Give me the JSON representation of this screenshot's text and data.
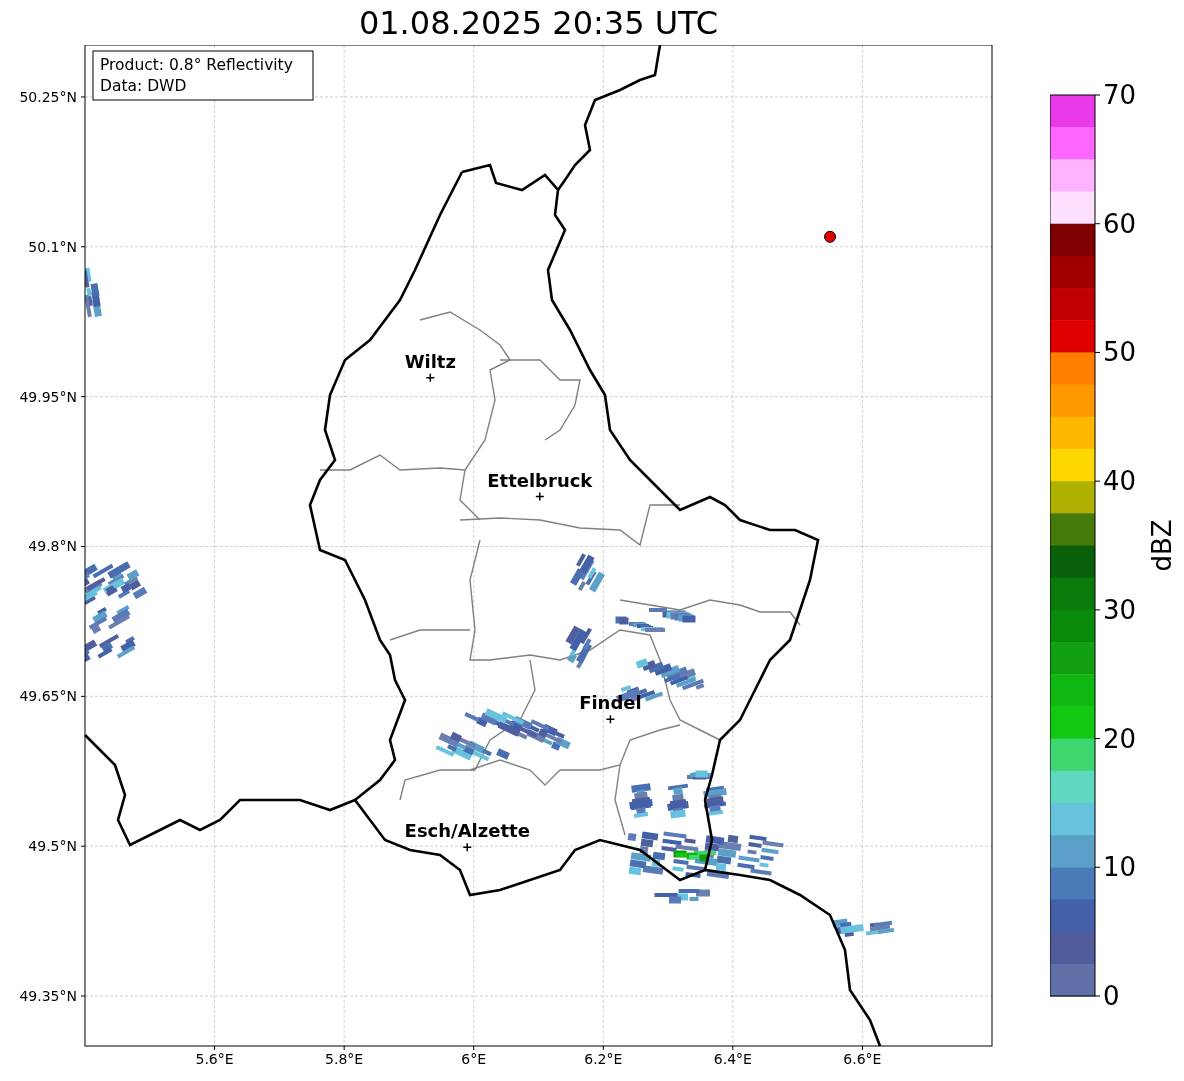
{
  "title": "01.08.2025 20:35 UTC",
  "info_box": [
    "Product: 0.8° Reflectivity",
    "Data: DWD"
  ],
  "map": {
    "x_ticks": [
      "5.6°E",
      "5.8°E",
      "6°E",
      "6.2°E",
      "6.4°E",
      "6.6°E"
    ],
    "y_ticks": [
      "50.25°N",
      "50.1°N",
      "49.95°N",
      "49.8°N",
      "49.65°N",
      "49.5°N",
      "49.35°N"
    ],
    "cities": [
      "Wiltz",
      "Ettelbruck",
      "Findel",
      "Esch/Alzette"
    ]
  },
  "colorbar": {
    "label": "dBZ",
    "ticks": [
      "70",
      "60",
      "50",
      "40",
      "30",
      "20",
      "10",
      "0"
    ],
    "segments": [
      {
        "color": "#e83ae8"
      },
      {
        "color": "#ff66ff"
      },
      {
        "color": "#ffb3ff"
      },
      {
        "color": "#ffe0ff"
      },
      {
        "color": "#7f0000"
      },
      {
        "color": "#a00000"
      },
      {
        "color": "#c00000"
      },
      {
        "color": "#e00000"
      },
      {
        "color": "#ff7f00"
      },
      {
        "color": "#ff9900"
      },
      {
        "color": "#ffb800"
      },
      {
        "color": "#ffd700"
      },
      {
        "color": "#b0b000"
      },
      {
        "color": "#467a0a"
      },
      {
        "color": "#0a5f0a"
      },
      {
        "color": "#0a7a0a"
      },
      {
        "color": "#0a8a0a"
      },
      {
        "color": "#12a012"
      },
      {
        "color": "#12b812"
      },
      {
        "color": "#12c812"
      },
      {
        "color": "#3ed66e"
      },
      {
        "color": "#5fd8c0"
      },
      {
        "color": "#66c2dd"
      },
      {
        "color": "#5aa0c8"
      },
      {
        "color": "#4a7ab8"
      },
      {
        "color": "#4460a8"
      },
      {
        "color": "#505c9c"
      },
      {
        "color": "#6070a8"
      }
    ]
  }
}
